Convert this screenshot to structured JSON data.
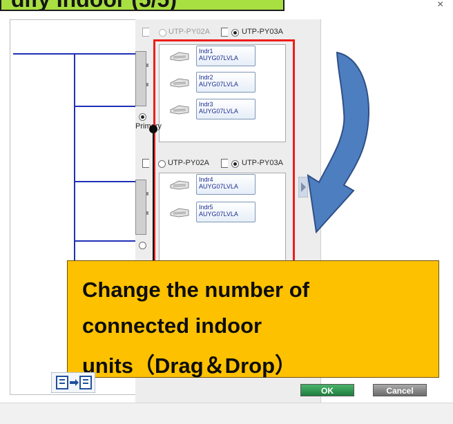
{
  "title": "dify Indoor (5/5)",
  "window": {
    "close_glyph": "×"
  },
  "groups": [
    {
      "options": [
        {
          "label": "UTP-PY02A",
          "selected": false,
          "dimmed": true
        },
        {
          "label": "UTP-PY03A",
          "selected": true,
          "dimmed": false
        }
      ],
      "units": [
        {
          "name": "Indr1",
          "model": "AUYG07LVLA"
        },
        {
          "name": "Indr2",
          "model": "AUYG07LVLA"
        },
        {
          "name": "Indr3",
          "model": "AUYG07LVLA"
        }
      ],
      "primary_label": "Primary",
      "primary_selected": true
    },
    {
      "options": [
        {
          "label": "UTP-PY02A",
          "selected": false,
          "dimmed": false
        },
        {
          "label": "UTP-PY03A",
          "selected": true,
          "dimmed": false
        }
      ],
      "units": [
        {
          "name": "Indr4",
          "model": "AUYG07LVLA"
        },
        {
          "name": "Indr5",
          "model": "AUYG07LVLA"
        }
      ],
      "primary_selected": false
    }
  ],
  "callout": {
    "lines": [
      "Change the number of",
      "connected indoor",
      "units（Drag＆Drop）"
    ]
  },
  "buttons": {
    "ok": "OK",
    "cancel": "Cancel"
  },
  "colors": {
    "banner": "#a8df41",
    "callout": "#fdc100",
    "highlight_frame": "#ee1c1c",
    "arrow": "#4d7ec0",
    "pipe": "#1f2fb5"
  },
  "icons": [
    "ceiling-cassette-icon",
    "swap-layout-icon",
    "curved-arrow-icon"
  ]
}
